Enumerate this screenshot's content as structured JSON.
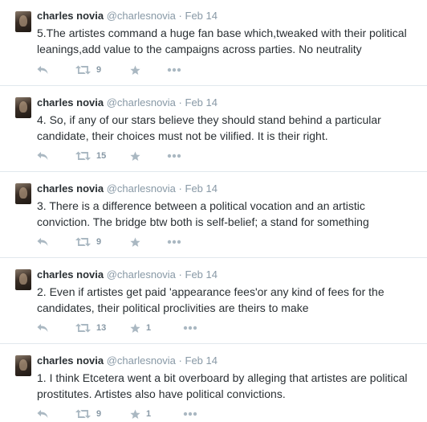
{
  "tweets": [
    {
      "name": "charles novia",
      "handle": "@charlesnovia",
      "separator": "·",
      "date": "Feb 14",
      "text": "5.The artistes command a huge fan base which,tweaked with their political leanings,add value to the campaigns across parties. No neutrality",
      "retweets": "9",
      "favorites": ""
    },
    {
      "name": "charles novia",
      "handle": "@charlesnovia",
      "separator": "·",
      "date": "Feb 14",
      "text": "4. So, if any of our stars believe they should stand behind a particular candidate, their choices must not be vilified. It is their right.",
      "retweets": "15",
      "favorites": ""
    },
    {
      "name": "charles novia",
      "handle": "@charlesnovia",
      "separator": "·",
      "date": "Feb 14",
      "text": "3. There is a difference between a political vocation and an artistic conviction. The bridge btw both is self-belief; a stand for something",
      "retweets": "9",
      "favorites": ""
    },
    {
      "name": "charles novia",
      "handle": "@charlesnovia",
      "separator": "·",
      "date": "Feb 14",
      "text": "2. Even if artistes get paid 'appearance fees'or any kind of fees for the candidates, their political proclivities are theirs to make",
      "retweets": "13",
      "favorites": "1"
    },
    {
      "name": "charles novia",
      "handle": "@charlesnovia",
      "separator": "·",
      "date": "Feb 14",
      "text": "1. I think Etcetera went a bit overboard by alleging that artistes are political prostitutes. Artistes also have political convictions.",
      "retweets": "9",
      "favorites": "1"
    }
  ],
  "icons": {
    "reply": "reply-icon",
    "retweet": "retweet-icon",
    "favorite": "star-icon",
    "more": "more-icon"
  },
  "colors": {
    "name": "#292f33",
    "meta": "#8899a6",
    "icon": "#aab8c2",
    "divider": "#e1e8ed"
  }
}
